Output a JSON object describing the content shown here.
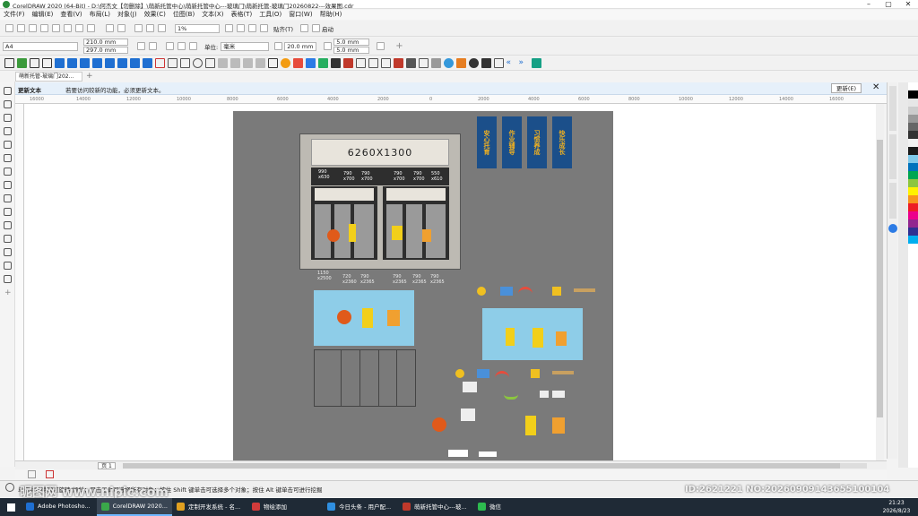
{
  "titlebar": {
    "title": "CorelDRAW 2020 (64-Bit) - D:\\何杰文【勿删除】\\萌新托管中心\\萌新托管中心---玻璃门\\萌新托管-玻璃门20260822---效果图.cdr"
  },
  "menu": [
    "文件(F)",
    "编辑(E)",
    "查看(V)",
    "布局(L)",
    "对象(J)",
    "效果(C)",
    "位图(B)",
    "文本(X)",
    "表格(T)",
    "工具(O)",
    "窗口(W)",
    "帮助(H)"
  ],
  "toolbar1": {
    "zoom": "1%",
    "snap_label": "贴齐(T)",
    "launch_label": "启动"
  },
  "propbar": {
    "page_size": "A4",
    "width": "210.0 mm",
    "height": "297.0 mm",
    "unit_label": "单位:",
    "unit": "毫米",
    "nudge": "20.0 mm",
    "dup_x": "5.0 mm",
    "dup_y": "5.0 mm"
  },
  "doc_tab": "萌新托管-玻璃门202...",
  "notice": {
    "title": "更新文本",
    "message": "若要访问较新的功能，必须更新文本。",
    "button": "更新(E)"
  },
  "ruler_ticks": [
    "16000",
    "14000",
    "12000",
    "10000",
    "8000",
    "6000",
    "4000",
    "2000",
    "0",
    "2000",
    "4000",
    "6000",
    "8000",
    "10000",
    "12000",
    "14000",
    "16000"
  ],
  "design": {
    "door_size": "6260X1300",
    "top_labels": [
      "990\nx630",
      "790\nx700",
      "790\nx700",
      "790\nx700",
      "790\nx700",
      "550\nx610"
    ],
    "bottom_labels": [
      "1150\nx2500",
      "720\nx2360",
      "790\nx2365",
      "790\nx2365",
      "790\nx2365",
      "790\nx2365"
    ],
    "banners": [
      "安心托育",
      "作业辅导",
      "习惯养成",
      "快乐成长"
    ]
  },
  "page_tab": "页 1",
  "status": {
    "hint": "单击对象两次可旋转/倾斜；双击工具可选择所有对象；按住 Shift 键单击可选择多个对象；按住 Alt 键单击可进行挖掘",
    "watermark_left": "昵图网 www.nipic.com",
    "watermark_right": "ID:2621221 NO:20260909143655100104"
  },
  "taskbar": {
    "apps": [
      {
        "label": "Adobe Photosho...",
        "color": "#1f6fd1"
      },
      {
        "label": "CorelDRAW 2020...",
        "color": "#3aa84a"
      },
      {
        "label": "定制开发系统 - 名...",
        "color": "#e0a020"
      },
      {
        "label": "物绘添加",
        "color": "#d23b3b"
      },
      {
        "label": "今日头条 - 用户配...",
        "color": "#2f8fe0"
      },
      {
        "label": "萌新托管中心---玻...",
        "color": "#c0392b"
      },
      {
        "label": "微信",
        "color": "#2dbb4f"
      }
    ],
    "time": "21:23",
    "date": "2026/8/23"
  },
  "palette": [
    "#ffffff",
    "#000000",
    "#e6e6e6",
    "#cccccc",
    "#999999",
    "#666666",
    "#333333",
    "#f2f2f2",
    "#1a1a1a",
    "#7fc9ea",
    "#0072bc",
    "#00a651",
    "#8dc63f",
    "#fff200",
    "#f7941d",
    "#ed1c24",
    "#ec008c",
    "#92278f",
    "#2e3192",
    "#00aeef",
    "#ffffff"
  ],
  "colors": {
    "accent": "#1b4f8a",
    "scene": "#8ecde8",
    "page": "#7a7a7a"
  }
}
